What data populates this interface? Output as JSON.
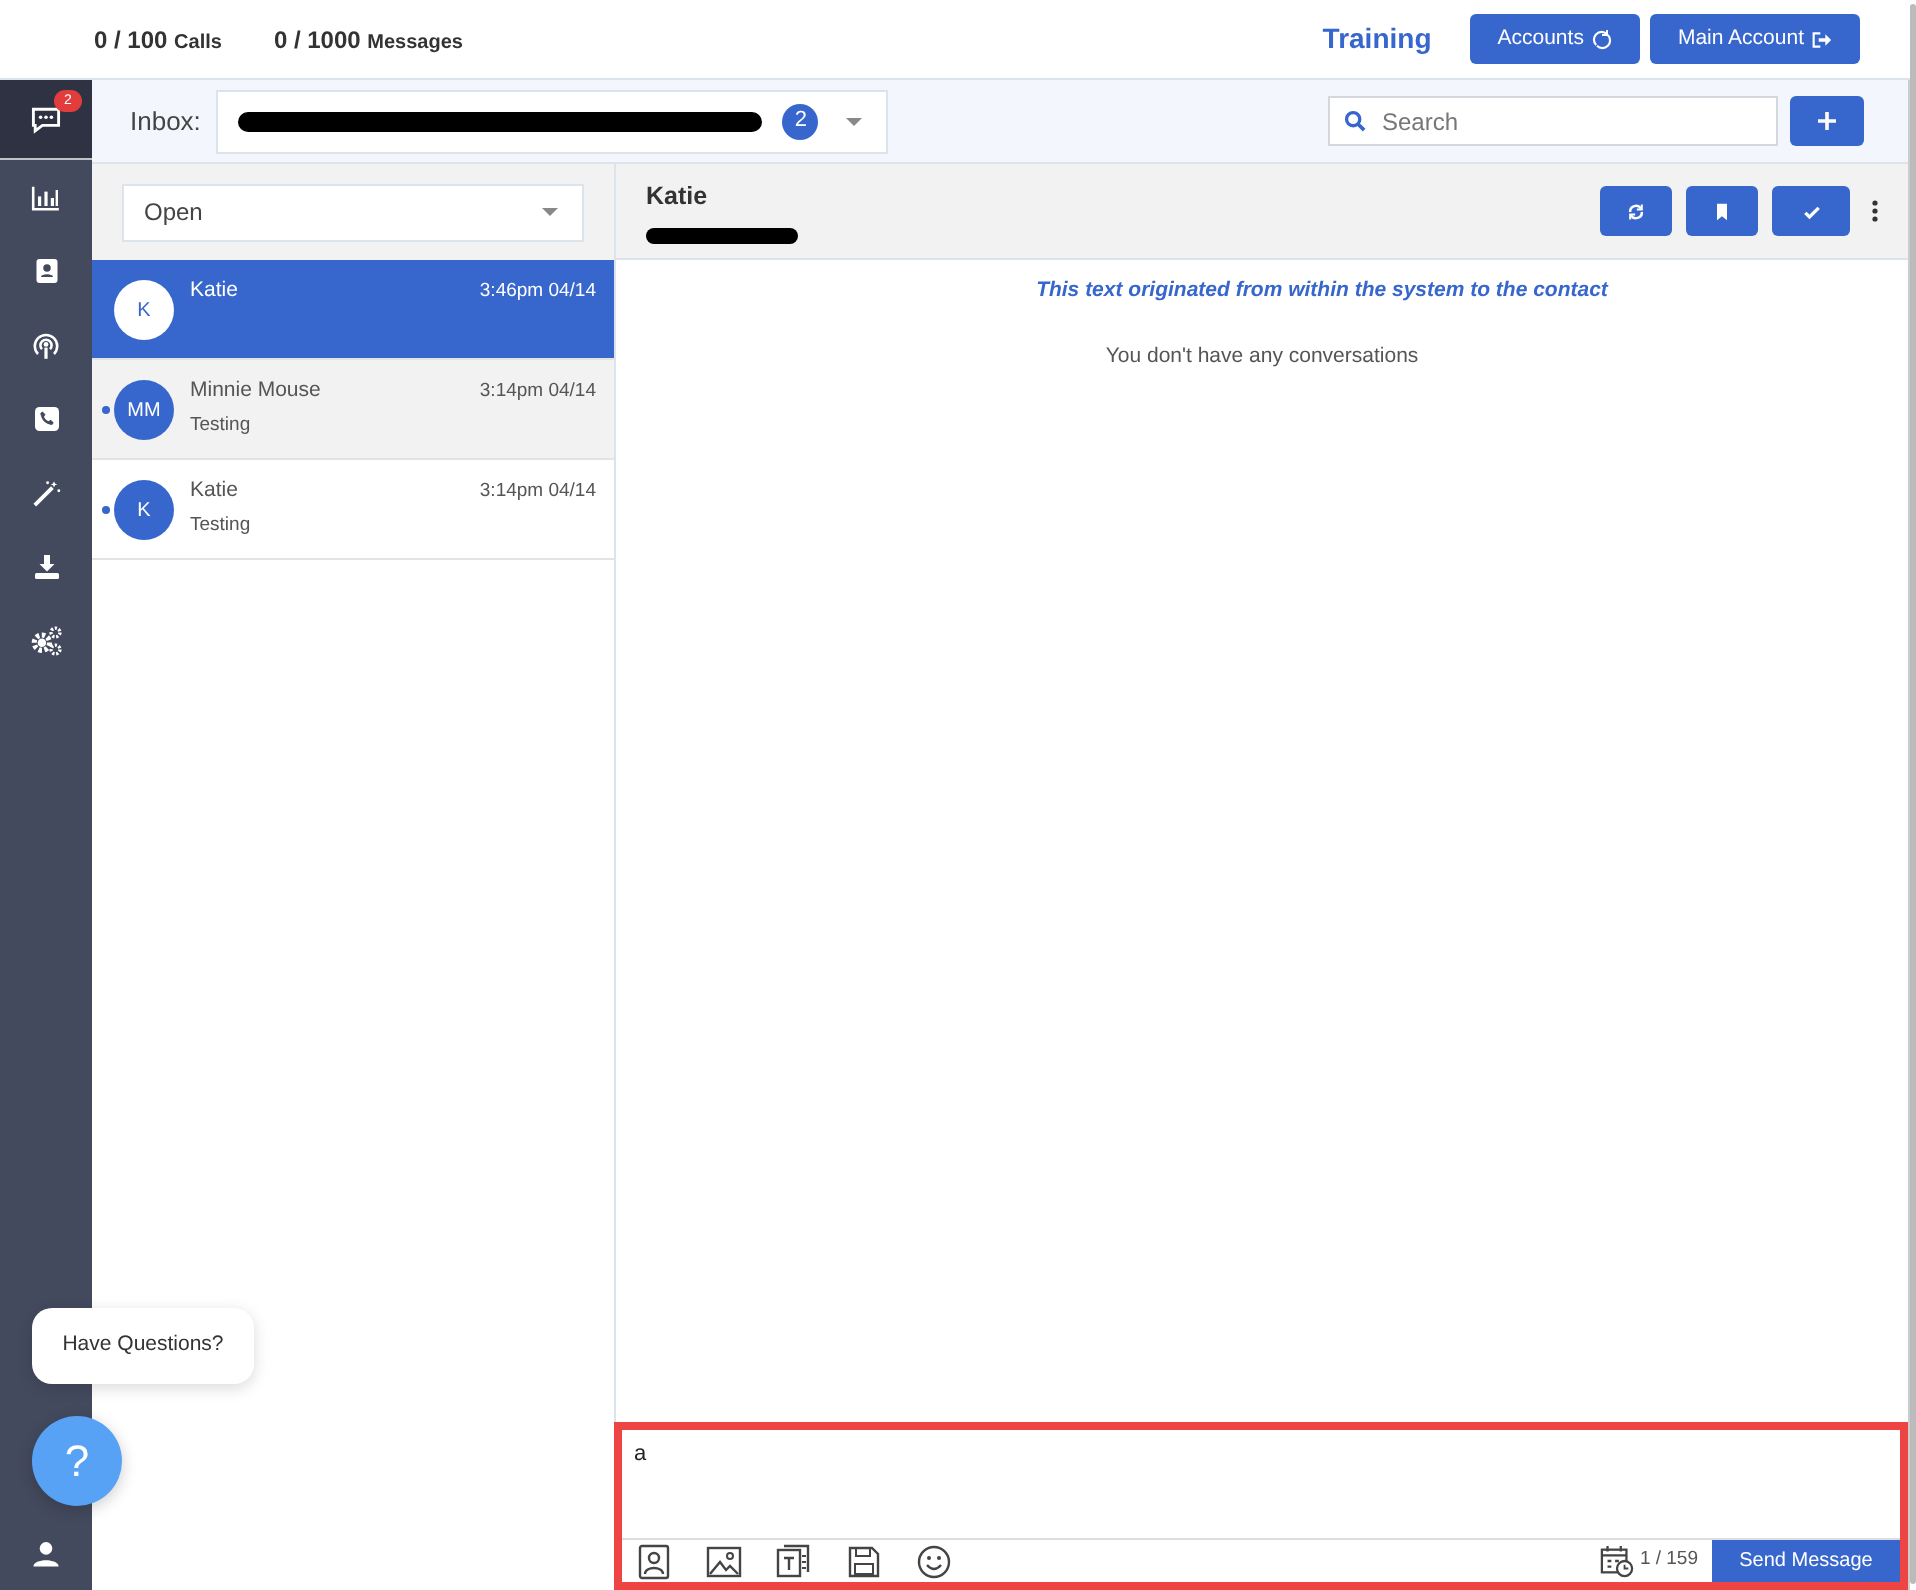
{
  "usage": [
    {
      "count": "0 / 100",
      "unit": "Calls"
    },
    {
      "count": "0 / 1000",
      "unit": "Messages"
    }
  ],
  "top_bar": {
    "account_name": "Training",
    "buttons": [
      {
        "label": "Accounts",
        "kind": "sync"
      },
      {
        "label": "Main Account",
        "kind": "exit"
      }
    ]
  },
  "sidebar": {
    "items": [
      {
        "kind": "chat",
        "selected": true,
        "badge": "2"
      },
      {
        "kind": "chart",
        "selected": false
      },
      {
        "kind": "contacts",
        "selected": false
      },
      {
        "kind": "broadcast",
        "selected": false
      },
      {
        "kind": "phone",
        "selected": false
      },
      {
        "kind": "wand",
        "selected": false
      },
      {
        "kind": "download",
        "selected": false
      },
      {
        "kind": "gears",
        "selected": false
      }
    ]
  },
  "inbox": {
    "label": "Inbox:",
    "count": "2"
  },
  "search": {
    "placeholder": "Search"
  },
  "filter": {
    "value": "Open"
  },
  "conversations": [
    {
      "initials": "K",
      "name": "Katie",
      "time": "3:46pm 04/14",
      "selected": true,
      "unread": false
    },
    {
      "initials": "MM",
      "name": "Minnie Mouse",
      "time": "3:14pm 04/14",
      "preview": "Testing",
      "selected": false,
      "unread": true
    },
    {
      "initials": "K",
      "name": "Katie",
      "time": "3:14pm 04/14",
      "preview": "Testing",
      "selected": false,
      "unread": true
    }
  ],
  "chat": {
    "contact_name": "Katie",
    "origin_note": "This text originated from within the system to the contact",
    "empty_message": "You don't have any conversations"
  },
  "composer": {
    "value": "a",
    "char_count": "1 / 159",
    "send_label": "Send Message"
  },
  "help": {
    "bubble": "Have Questions?",
    "button": "?"
  }
}
